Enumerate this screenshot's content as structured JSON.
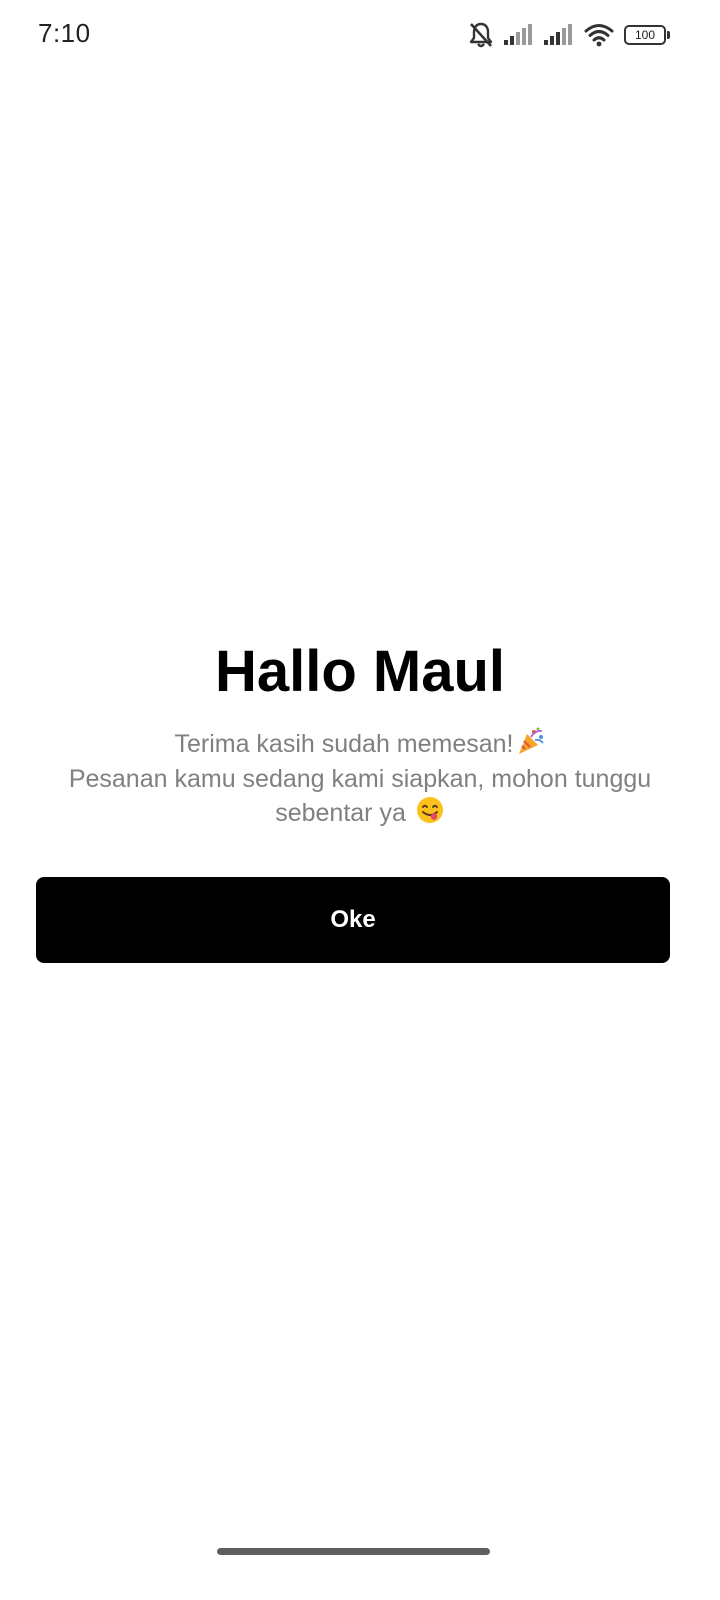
{
  "status_bar": {
    "time": "7:10",
    "icons": [
      "bell-off-icon",
      "signal-icon",
      "signal-icon",
      "wifi-icon",
      "battery-icon"
    ],
    "battery_level": "100"
  },
  "main": {
    "title": "Hallo Maul",
    "message_line1": "Terima kasih sudah memesan!",
    "message_line2": "Pesanan kamu sedang kami siapkan, mohon tunggu",
    "message_line3": "sebentar ya",
    "emoji1": "party-popper-icon",
    "emoji2": "face-savoring-food-icon"
  },
  "actions": {
    "ok_label": "Oke"
  },
  "colors": {
    "button_bg": "#000000",
    "button_text": "#ffffff",
    "message_text": "#808080",
    "background": "#ffffff"
  }
}
